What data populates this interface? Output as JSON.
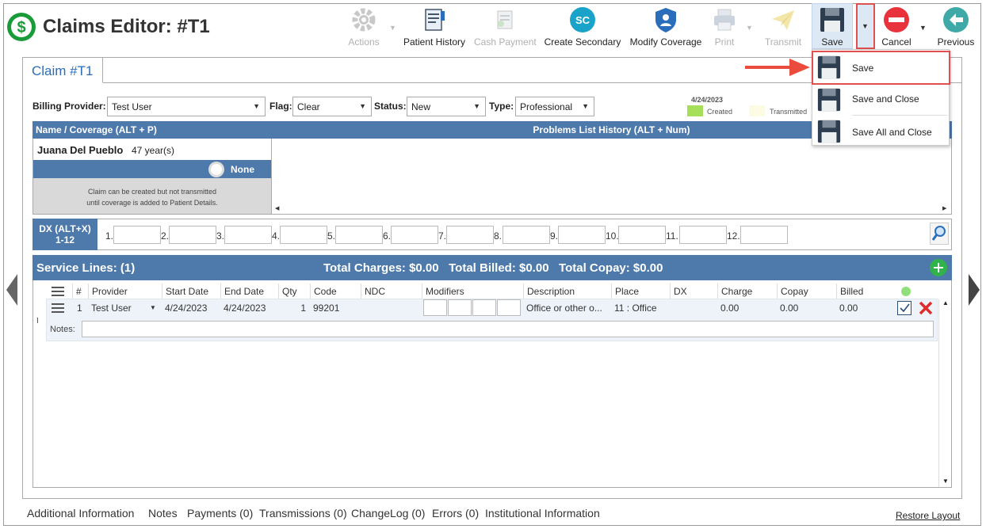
{
  "app": {
    "title": "Claims Editor: #T1"
  },
  "toolbar": {
    "actions": "Actions",
    "patient_history": "Patient History",
    "cash_payment": "Cash Payment",
    "create_secondary": "Create Secondary",
    "create_secondary_badge": "SC",
    "modify_coverage": "Modify Coverage",
    "print": "Print",
    "transmit": "Transmit",
    "save": "Save",
    "cancel": "Cancel",
    "previous": "Previous"
  },
  "save_menu": {
    "items": [
      "Save",
      "Save and Close",
      "Save All and Close"
    ]
  },
  "tab": {
    "label": "Claim #T1"
  },
  "filters": {
    "billing_provider_label": "Billing Provider:",
    "billing_provider": "Test User",
    "flag_label": "Flag:",
    "flag": "Clear",
    "status_label": "Status:",
    "status": "New",
    "type_label": "Type:",
    "type": "Professional"
  },
  "legend": {
    "date": "4/24/2023",
    "created": "Created",
    "transmitted": "Transmitted"
  },
  "patient": {
    "header": "Name / Coverage (ALT + P)",
    "name": "Juana Del Pueblo",
    "age": "47 year(s)",
    "coverage": "None",
    "note_line1": "Claim can be created but not transmitted",
    "note_line2": "until coverage is added to Patient Details."
  },
  "problems": {
    "header": "Problems List History (ALT + Num)"
  },
  "dx": {
    "label_line1": "DX (ALT+X)",
    "label_line2": "1-12",
    "fields": [
      "1.",
      "2.",
      "3.",
      "4.",
      "5.",
      "6.",
      "7.",
      "8.",
      "9.",
      "10.",
      "11.",
      "12."
    ]
  },
  "service_lines": {
    "title": "Service Lines: (1)",
    "totals": "Total Charges: $0.00   Total Billed: $0.00   Total Copay: $0.00",
    "columns": [
      "#",
      "Provider",
      "Start Date",
      "End Date",
      "Qty",
      "Code",
      "NDC",
      "Modifiers",
      "Description",
      "Place",
      "DX",
      "Charge",
      "Copay",
      "Billed"
    ],
    "row": {
      "num": "1",
      "provider": "Test User",
      "start_date": "4/24/2023",
      "end_date": "4/24/2023",
      "qty": "1",
      "code": "99201",
      "ndc": "",
      "description": "Office or other o...",
      "place": "11 : Office",
      "dx": "",
      "charge": "0.00",
      "copay": "0.00",
      "billed": "0.00"
    },
    "notes_label": "Notes:"
  },
  "bottom_tabs": [
    "Additional Information",
    "Notes",
    "Payments (0)",
    "Transmissions (0)",
    "ChangeLog (0)",
    "Errors (0)",
    "Institutional Information"
  ],
  "restore_layout": "Restore Layout",
  "colors": {
    "accent": "#2a6ebb",
    "header": "#4d79ab",
    "highlight": "#e05050",
    "created": "#a6e05a",
    "transmitted": "#fdfbe3"
  }
}
